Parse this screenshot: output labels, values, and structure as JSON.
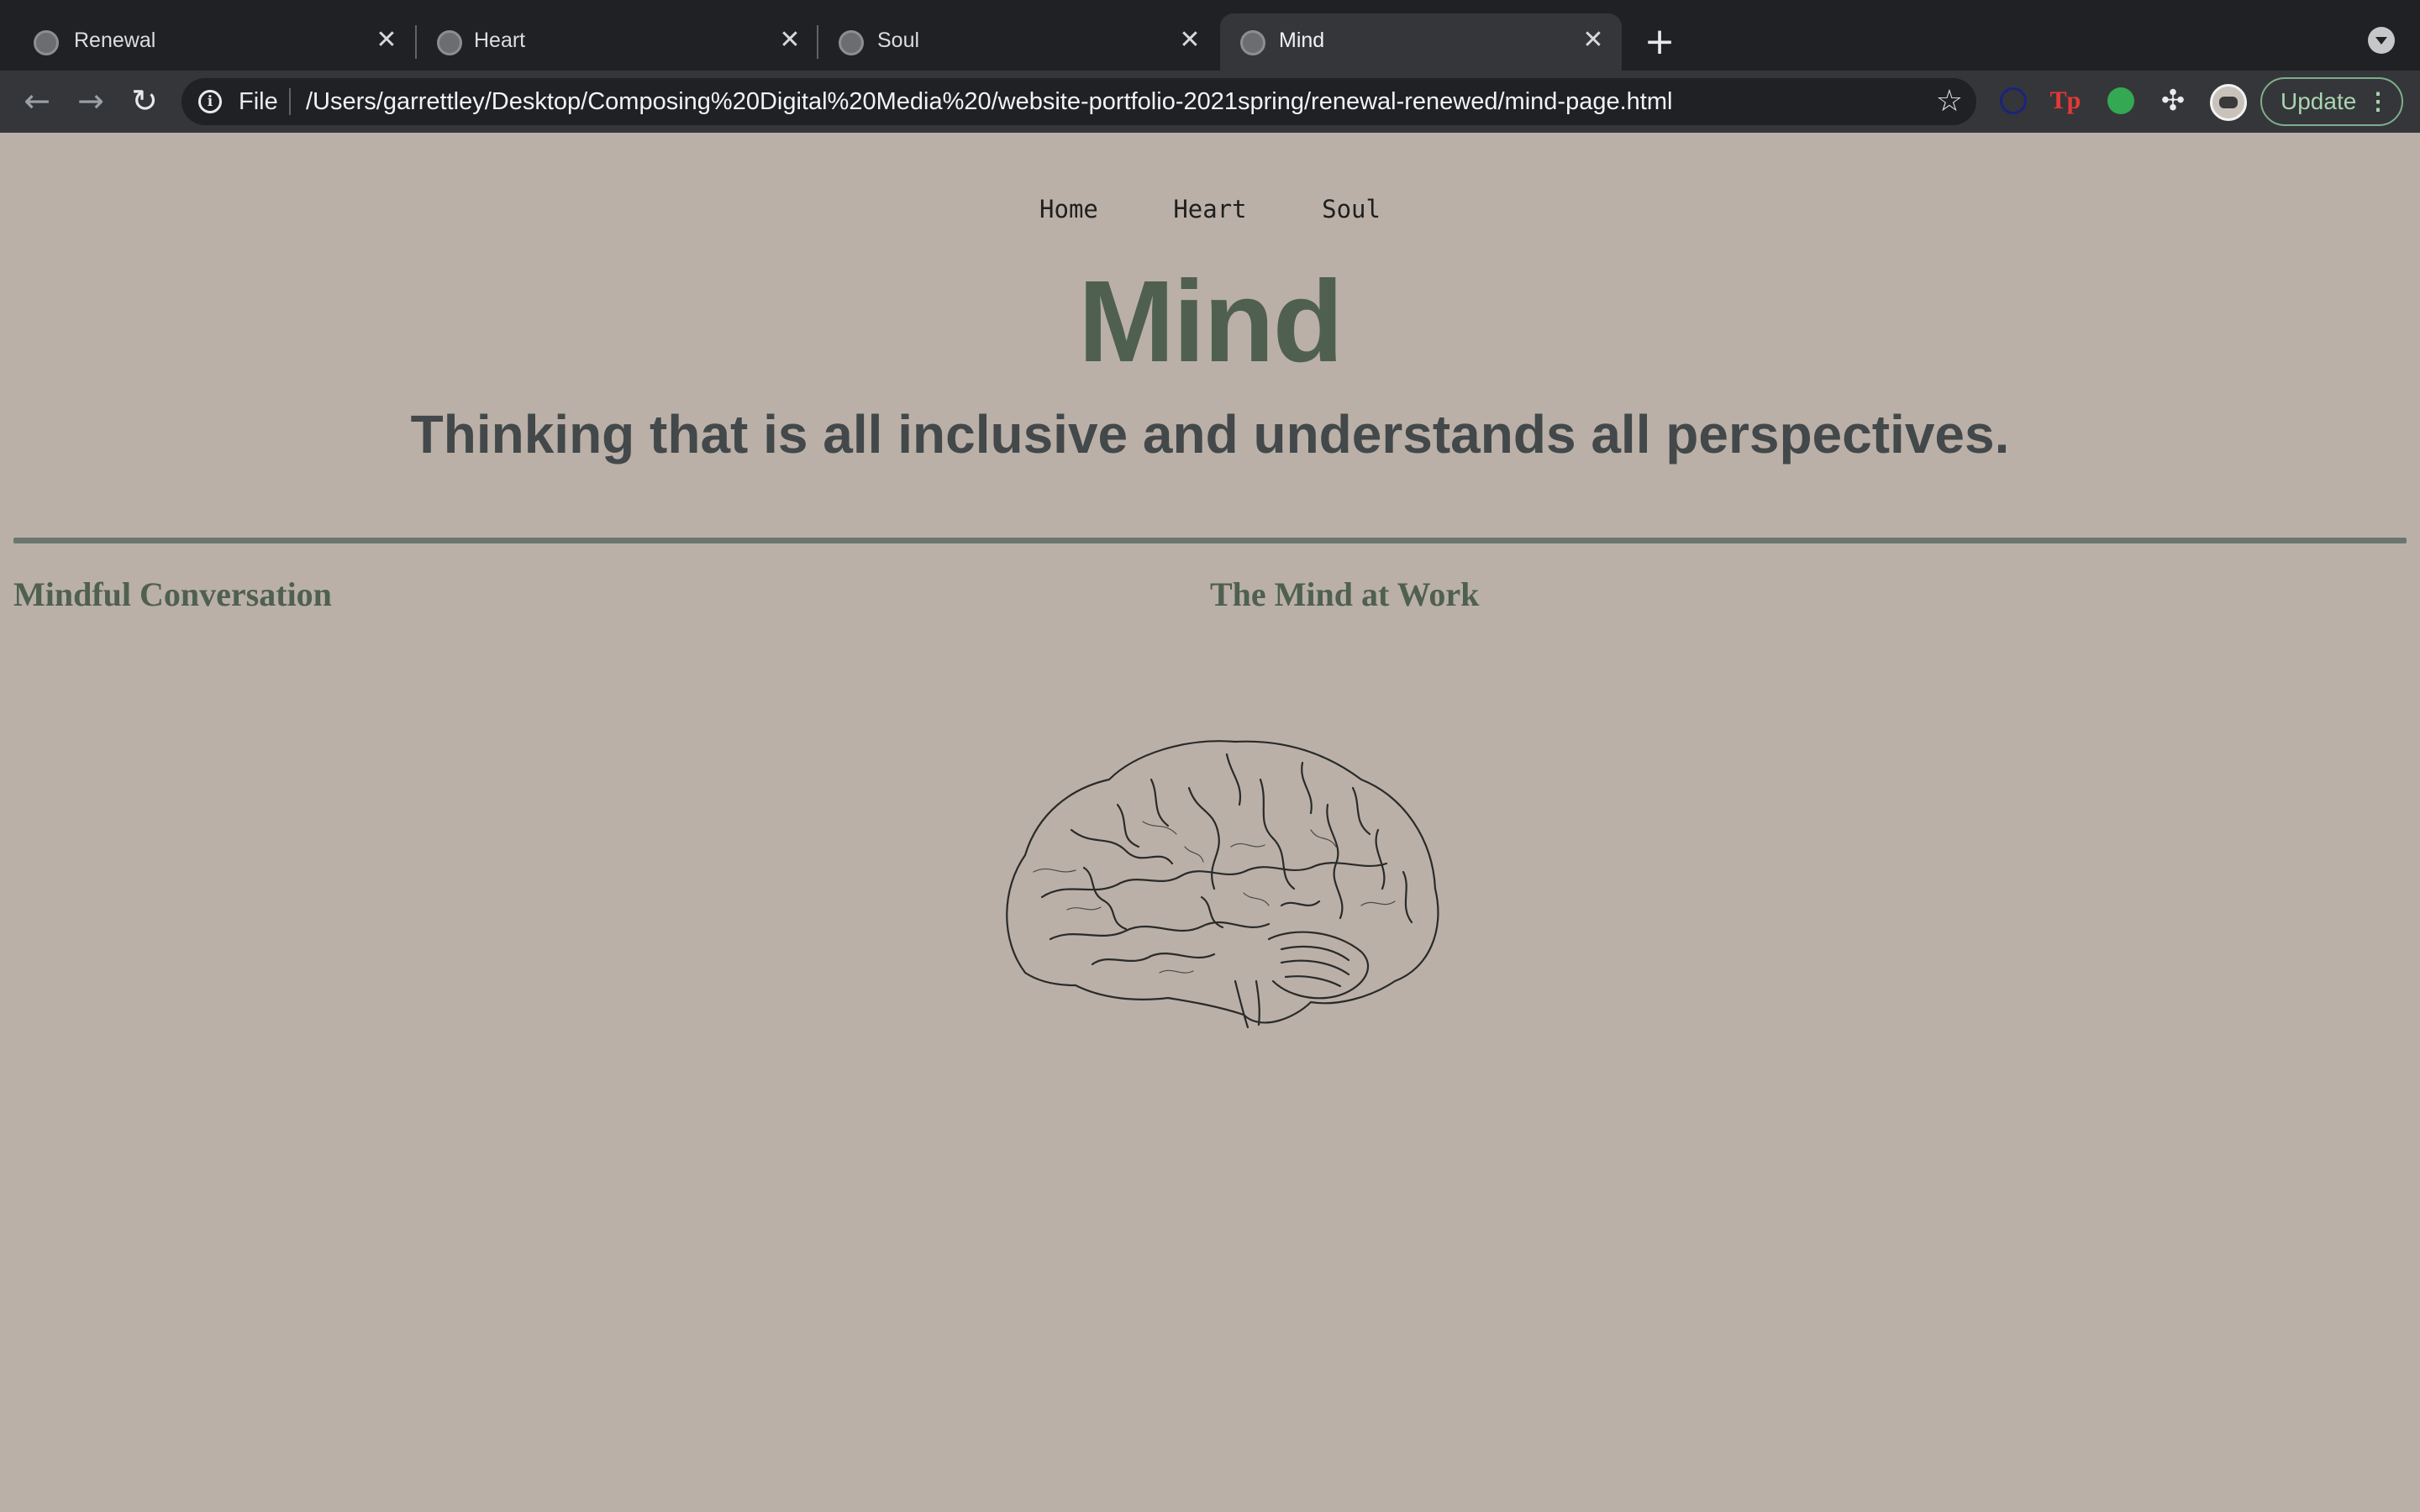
{
  "browser": {
    "tabs": [
      {
        "title": "Renewal",
        "active": false
      },
      {
        "title": "Heart",
        "active": false
      },
      {
        "title": "Soul",
        "active": false
      },
      {
        "title": "Mind",
        "active": true
      }
    ],
    "close_glyph": "✕",
    "new_tab_glyph": "+",
    "scheme_label": "File",
    "url": "/Users/garrettley/Desktop/Composing%20Digital%20Media%20/website-portfolio-2021spring/renewal-renewed/mind-page.html",
    "update_label": "Update",
    "colors": {
      "tabstrip": "#202124",
      "toolbar": "#35363a",
      "update_accent": "#a8d5b0"
    }
  },
  "site": {
    "nav": [
      "Home",
      "Heart",
      "Soul"
    ],
    "title": "Mind",
    "subtitle": "Thinking that is all inclusive and understands all perspectives.",
    "sections": {
      "left_heading": "Mindful Conversation",
      "right_heading": "The Mind at Work"
    },
    "colors": {
      "background": "#bab0a7",
      "title": "#4f6050",
      "subtitle": "#43484a",
      "rule": "#6c7671"
    },
    "image": "brain-sketch"
  }
}
